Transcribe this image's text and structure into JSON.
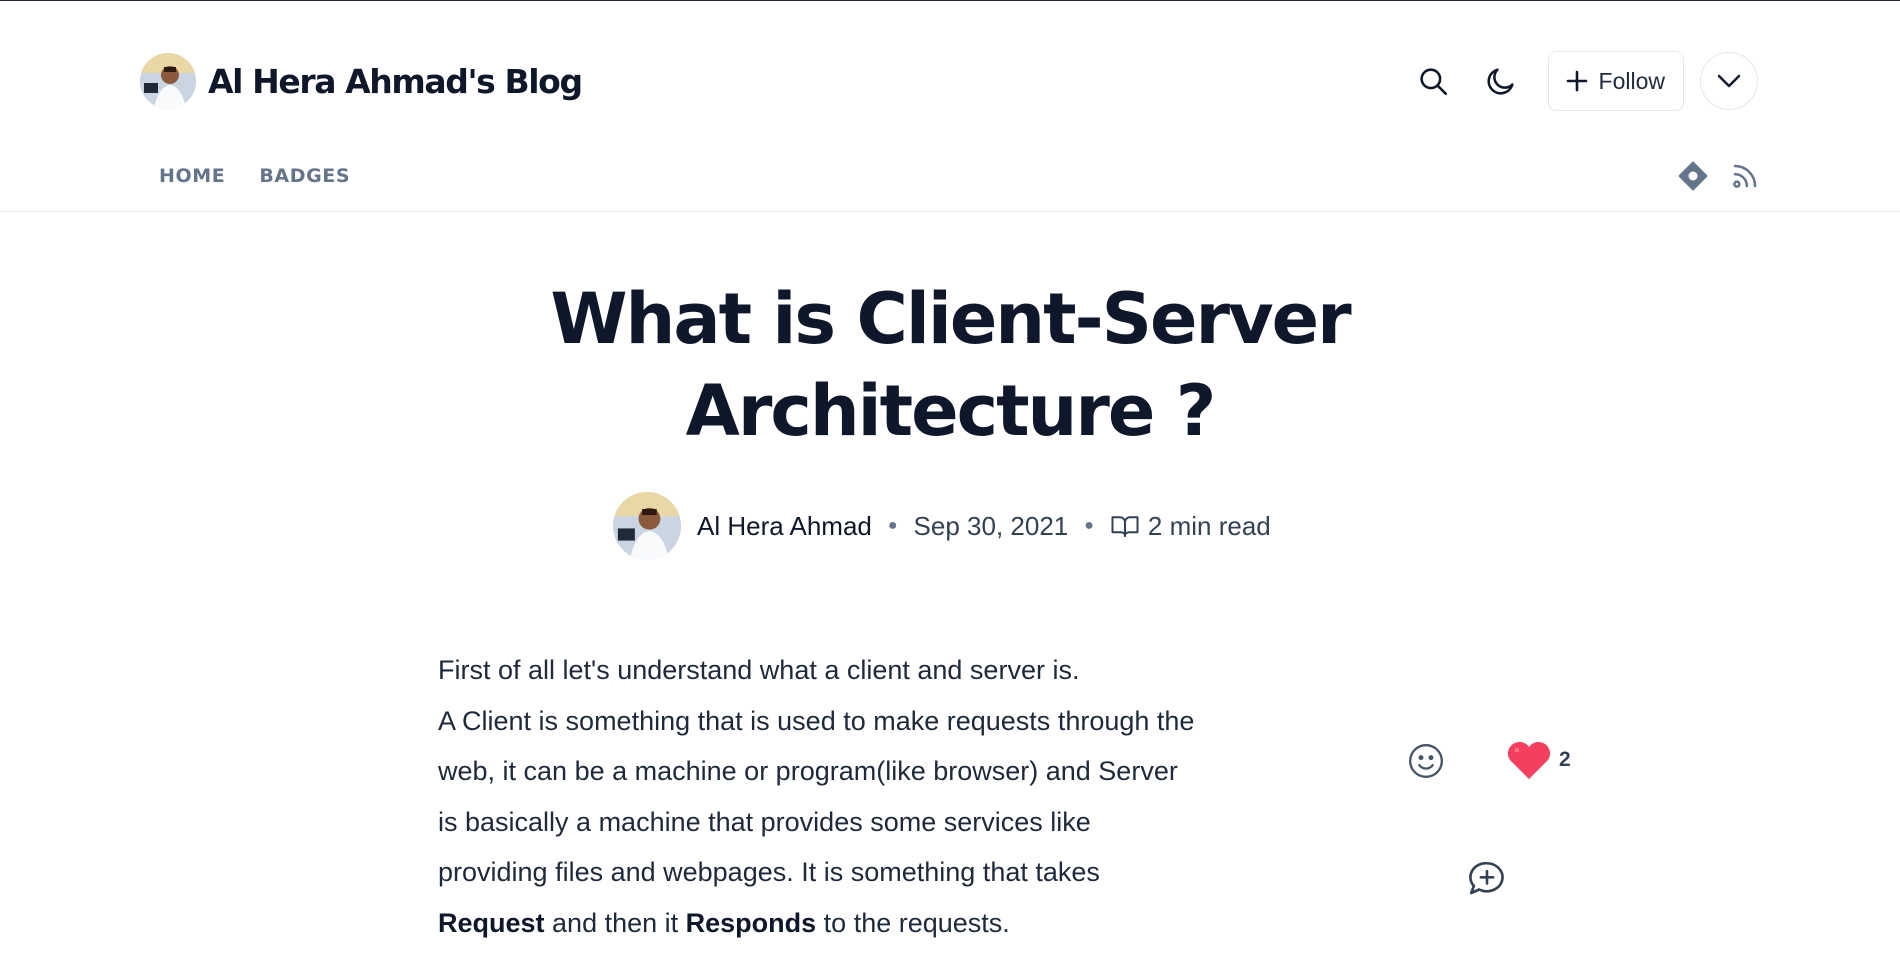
{
  "blog": {
    "title": "Al Hera Ahmad's Blog"
  },
  "header": {
    "search_icon": "search-icon",
    "theme_icon": "moon-icon",
    "follow_label": "Follow",
    "more_icon": "chevron-down-icon"
  },
  "nav": {
    "items": [
      {
        "label": "HOME"
      },
      {
        "label": "BADGES"
      }
    ]
  },
  "nav_icons": [
    "hashnode-icon",
    "rss-icon"
  ],
  "article": {
    "title_line1": "What is Client-Server",
    "title_line2": "Architecture ?",
    "author": "Al Hera Ahmad",
    "date": "Sep 30, 2021",
    "read_time": "2 min read",
    "p1": "First of all let's understand what a client and server is.",
    "p2_lines": [
      "A Client is something that is used to make requests through the",
      "web, it can be a machine or program(like browser) and Server",
      "is basically a machine that provides some services like",
      "providing files and webpages. It is something that takes"
    ],
    "p2_last": {
      "b1": "Request",
      "t1": " and then it ",
      "b2": "Responds",
      "t2": " to the requests."
    }
  },
  "reactions": {
    "heart_count": "2"
  },
  "colors": {
    "text": "#0f172a",
    "muted": "#64748b",
    "heart": "#f43f5e",
    "border": "#e5e7eb"
  }
}
